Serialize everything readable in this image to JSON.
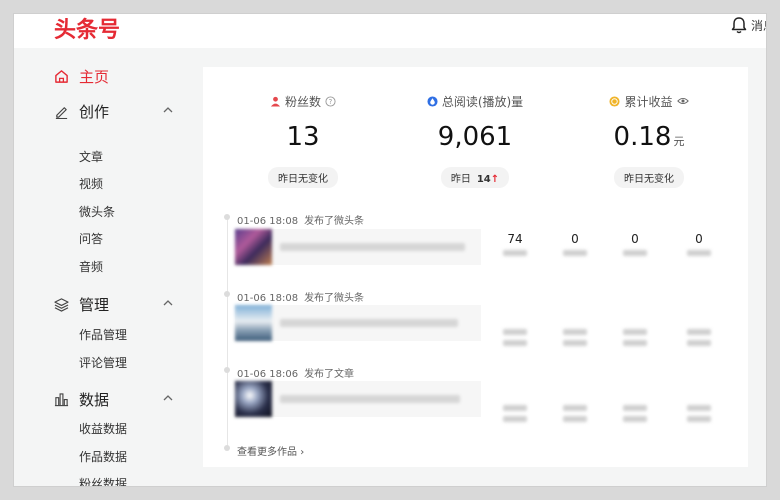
{
  "header": {
    "logo": "头条号",
    "messages_label": "消息"
  },
  "sidebar": {
    "home": "主页",
    "create": {
      "label": "创作",
      "items": [
        "文章",
        "视频",
        "微头条",
        "问答",
        "音频"
      ]
    },
    "manage": {
      "label": "管理",
      "items": [
        "作品管理",
        "评论管理"
      ]
    },
    "data": {
      "label": "数据",
      "items": [
        "收益数据",
        "作品数据",
        "粉丝数据"
      ]
    }
  },
  "stats": [
    {
      "label": "粉丝数",
      "value": "13",
      "unit": "",
      "change_label": "昨日无变化",
      "change_value": "",
      "change_arrow": ""
    },
    {
      "label": "总阅读(播放)量",
      "value": "9,061",
      "unit": "",
      "change_label": "昨日",
      "change_value": "14",
      "change_arrow": "↑"
    },
    {
      "label": "累计收益",
      "value": "0.18",
      "unit": "元",
      "change_label": "昨日无变化",
      "change_value": "",
      "change_arrow": ""
    }
  ],
  "posts": [
    {
      "time": "01-06 18:08",
      "action": "发布了微头条",
      "metrics": [
        "74",
        "0",
        "0",
        "0"
      ]
    },
    {
      "time": "01-06 18:08",
      "action": "发布了微头条",
      "metrics": [
        "",
        "",
        "",
        ""
      ]
    },
    {
      "time": "01-06 18:06",
      "action": "发布了文章",
      "metrics": [
        "",
        "",
        "",
        ""
      ]
    }
  ],
  "more_link": "查看更多作品",
  "colors": {
    "brand": "#e52a34",
    "accent_blue": "#2f6fe4",
    "accent_gold": "#f0b429"
  }
}
